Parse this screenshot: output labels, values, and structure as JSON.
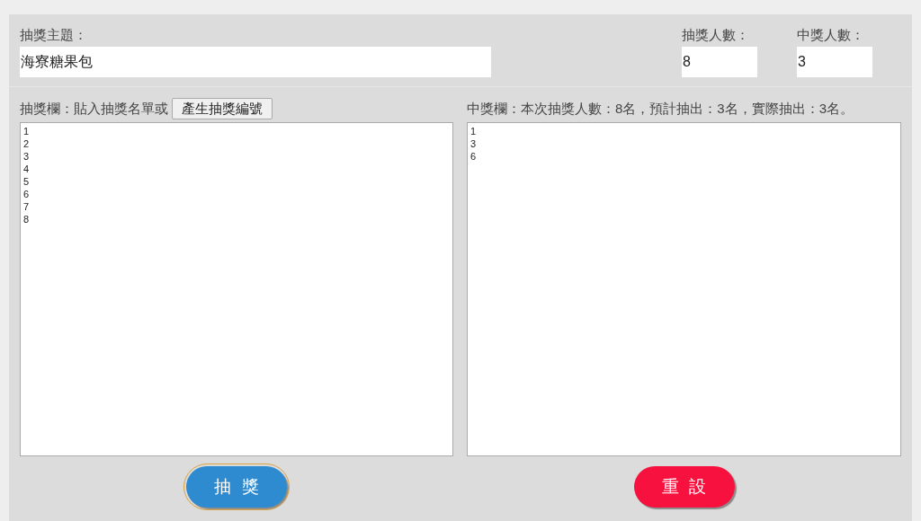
{
  "topic": {
    "label": "抽獎主題：",
    "value": "海寮糖果包"
  },
  "counts": [
    {
      "label": "抽獎人數：",
      "value": "8"
    },
    {
      "label": "中獎人數：",
      "value": "3"
    }
  ],
  "entry_panel": {
    "label": "抽獎欄：貼入抽獎名單或",
    "button": "產生抽獎編號",
    "lines": [
      "1",
      "2",
      "3",
      "4",
      "5",
      "6",
      "7",
      "8"
    ]
  },
  "winner_panel": {
    "label": "中獎欄：本次抽獎人數：8名，預計抽出：3名，實際抽出：3名。",
    "lines": [
      "1",
      "3",
      "6"
    ]
  },
  "buttons": [
    {
      "label": "抽獎",
      "kind": "draw",
      "focused": true
    },
    {
      "label": "重設",
      "kind": "reset",
      "focused": false
    }
  ]
}
